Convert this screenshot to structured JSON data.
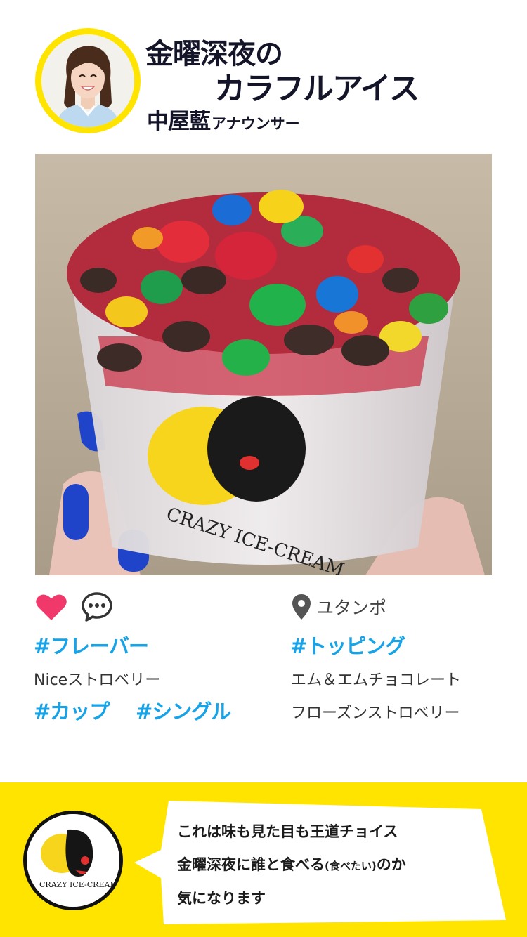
{
  "header": {
    "title_line1": "金曜深夜の",
    "title_line2": "カラフルアイス",
    "author_name": "中屋藍",
    "author_role": "アナウンサー"
  },
  "photo": {
    "cup_brand": "CRAZY ICE-CREAM"
  },
  "actions": {
    "like_icon": "heart-icon",
    "comment_icon": "comment-icon",
    "like_color": "#f0386b"
  },
  "location": {
    "icon": "map-pin-icon",
    "name": "ユタンポ"
  },
  "left_column": {
    "flavor_tag": "#フレーバー",
    "flavor_value": "Niceストロベリー",
    "cup_tag": "#カップ",
    "single_tag": "#シングル"
  },
  "right_column": {
    "topping_tag": "#トッピング",
    "toppings": [
      "エム＆エムチョコレート",
      "フローズンストロベリー"
    ]
  },
  "footer": {
    "logo_text": "CRAZY ICE-CREAM",
    "comment_line1": "これは味も見た目も王道チョイス",
    "comment_line2_main": "金曜深夜に誰と食べる",
    "comment_line2_small": "(食べたい)",
    "comment_line2_end": "のか",
    "comment_line3": "気になります"
  },
  "colors": {
    "brand_yellow": "#ffe400",
    "tag_blue": "#16a3e7",
    "title_navy": "#15152a"
  }
}
